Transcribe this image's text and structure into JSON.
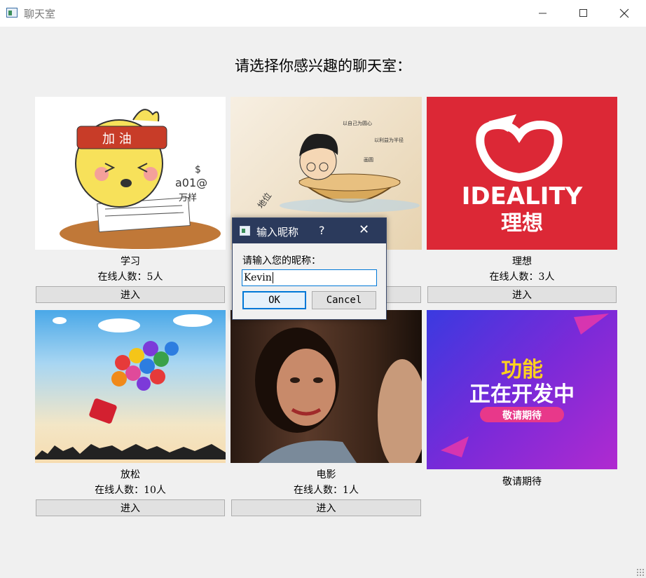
{
  "window": {
    "title": "聊天室",
    "minimize_icon": "minimize-icon",
    "maximize_icon": "maximize-icon",
    "close_icon": "close-icon"
  },
  "heading": "请选择你感兴趣的聊天室：",
  "rooms": [
    {
      "name": "学习",
      "online": "在线人数：5人",
      "enter": "进入",
      "image_text": [
        "加 油",
        "$",
        "a01@",
        "万样"
      ]
    },
    {
      "name": "",
      "online": "",
      "enter": "",
      "image_text": [
        "以自己为圆心",
        "以利益为半径",
        "画圆",
        "地位"
      ]
    },
    {
      "name": "理想",
      "online": "在线人数：3人",
      "enter": "进入",
      "image_text": [
        "IDEALITY",
        "理想"
      ]
    },
    {
      "name": "放松",
      "online": "在线人数：10人",
      "enter": "进入"
    },
    {
      "name": "电影",
      "online": "在线人数：1人",
      "enter": "进入"
    },
    {
      "name": "敬请期待",
      "image_text": [
        "功能",
        "正在开发中",
        "敬请期待"
      ]
    }
  ],
  "dialog": {
    "title": "输入昵称",
    "help": "?",
    "close": "✕",
    "prompt": "请输入您的昵称：",
    "value": "Kevin",
    "ok": "OK",
    "cancel": "Cancel"
  },
  "colors": {
    "titlebar": "#ffffff",
    "dialog_title": "#2b3a5c",
    "ideality_red": "#dc2836",
    "purple": "#8a2be2"
  }
}
